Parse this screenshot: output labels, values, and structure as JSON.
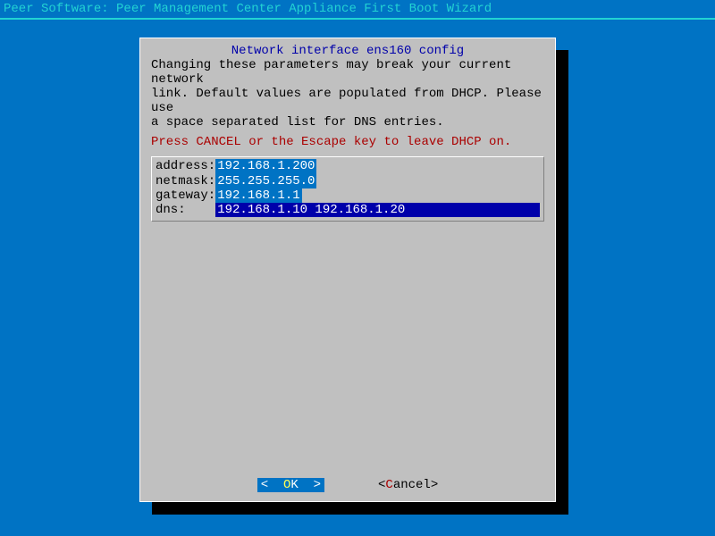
{
  "app_title": "Peer Software: Peer Management Center Appliance First Boot Wizard",
  "dialog": {
    "title": "Network interface ens160 config",
    "body": "Changing these parameters may break your current network\nlink. Default values are populated from DHCP. Please use\na space separated list for DNS entries.",
    "warning": "Press CANCEL or the Escape key to leave DHCP on."
  },
  "fields": {
    "address": {
      "label": "address:",
      "value": "192.168.1.200"
    },
    "netmask": {
      "label": "netmask:",
      "value": "255.255.255.0"
    },
    "gateway": {
      "label": "gateway:",
      "value": "192.168.1.1"
    },
    "dns": {
      "label": "dns:    ",
      "value": "192.168.1.10 192.168.1.20"
    }
  },
  "buttons": {
    "ok_left": "<  ",
    "ok_hot": "O",
    "ok_rest": "K  >",
    "cancel_left": "<",
    "cancel_hot": "C",
    "cancel_rest": "ancel>"
  }
}
